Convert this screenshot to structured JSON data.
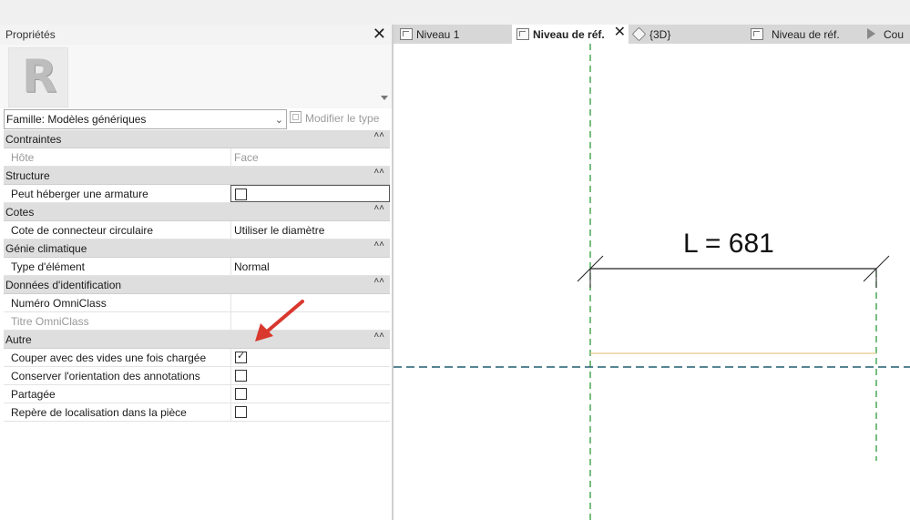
{
  "properties": {
    "title": "Propriétés",
    "close_icon": "close-icon",
    "family_select": "Famille: Modèles génériques",
    "edit_type_label": "Modifier le type",
    "groups": [
      {
        "name": "Contraintes",
        "rows": [
          {
            "label": "Hôte",
            "value": "Face",
            "dim": true
          }
        ]
      },
      {
        "name": "Structure",
        "rows": [
          {
            "label": "Peut héberger une armature",
            "checkbox": false
          }
        ]
      },
      {
        "name": "Cotes",
        "rows": [
          {
            "label": "Cote de connecteur circulaire",
            "value": "Utiliser le diamètre"
          }
        ]
      },
      {
        "name": "Génie climatique",
        "rows": [
          {
            "label": "Type d'élément",
            "value": "Normal"
          }
        ]
      },
      {
        "name": "Données d'identification",
        "rows": [
          {
            "label": "Numéro OmniClass",
            "value": ""
          },
          {
            "label": "Titre OmniClass",
            "value": "",
            "dim": true
          }
        ]
      },
      {
        "name": "Autre",
        "rows": [
          {
            "label": "Couper avec des vides une fois chargée",
            "checkbox": true
          },
          {
            "label": "Conserver l'orientation des annotations",
            "checkbox": false
          },
          {
            "label": "Partagée",
            "checkbox": false
          },
          {
            "label": "Repère de localisation dans la pièce",
            "checkbox": false
          }
        ]
      }
    ]
  },
  "tabs": [
    {
      "label": "Niveau 1",
      "active": false
    },
    {
      "label": "Niveau de réf.",
      "active": true
    },
    {
      "label": "{3D}",
      "active": false
    },
    {
      "label": "Niveau de réf.",
      "active": false
    },
    {
      "label": "Cou",
      "active": false
    }
  ],
  "canvas": {
    "dimension_label": "L = 681"
  },
  "colors": {
    "annotation_arrow": "#d9382e",
    "reference_plane_vertical": "#2e9a3a",
    "reference_plane_horizontal": "#1f5d6e",
    "model_line": "#e6c98a"
  }
}
